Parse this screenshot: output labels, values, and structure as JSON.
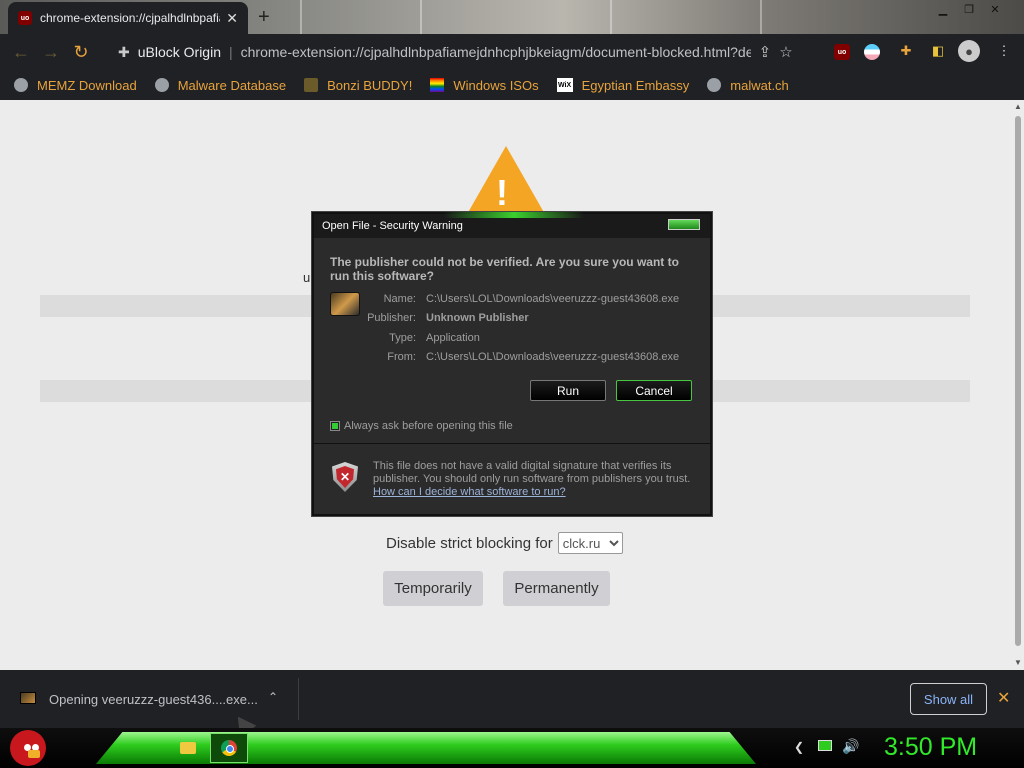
{
  "browser": {
    "tab_title": "chrome-extension://cjpalhdlnbpafiamejdnhcphjbkeiagm/document-blocked.html",
    "tab_favicon_text": "uo",
    "omnibox_site": "uBlock Origin",
    "omnibox_url": "chrome-extension://cjpalhdlnbpafiamejdnhcphjbkeiagm/document-blocked.html?details=...",
    "bookmarks": [
      {
        "label": "MEMZ Download",
        "icon": "globe-icon"
      },
      {
        "label": "Malware Database",
        "icon": "globe-icon"
      },
      {
        "label": "Bonzi BUDDY!",
        "icon": "bonzi-icon"
      },
      {
        "label": "Windows ISOs",
        "icon": "rainbow-flag-icon"
      },
      {
        "label": "Egyptian Embassy",
        "icon": "wix-icon",
        "icon_text": "WiX"
      },
      {
        "label": "malwat.ch",
        "icon": "globe-icon"
      }
    ],
    "accent_color": "#e8a33c"
  },
  "page": {
    "stray_text": "u",
    "disable_label": "Disable strict blocking for",
    "domain_select": "clck.ru",
    "btn_temporarily": "Temporarily",
    "btn_permanently": "Permanently",
    "warning_color": "#f4a523"
  },
  "dialog": {
    "title": "Open File - Security Warning",
    "question": "The publisher could not be verified.  Are you sure you want to run this software?",
    "fields": [
      {
        "key": "Name:",
        "value": "C:\\Users\\LOL\\Downloads\\veeruzzz-guest43608.exe"
      },
      {
        "key": "Publisher:",
        "value": "Unknown Publisher"
      },
      {
        "key": "Type:",
        "value": "Application"
      },
      {
        "key": "From:",
        "value": "C:\\Users\\LOL\\Downloads\\veeruzzz-guest43608.exe"
      }
    ],
    "run_label": "Run",
    "cancel_label": "Cancel",
    "checkbox_label": "Always ask before opening this file",
    "checkbox_checked": true,
    "info_text": "This file does not have a valid digital signature that verifies its publisher.  You should only run software from publishers you trust.",
    "info_link": "How can I decide what software to run?"
  },
  "downloads": {
    "item_text": "Opening veeruzzz-guest436....exe...",
    "show_all": "Show all"
  },
  "taskbar": {
    "clock": "3:50 PM",
    "accent_color": "#31ea2a"
  }
}
